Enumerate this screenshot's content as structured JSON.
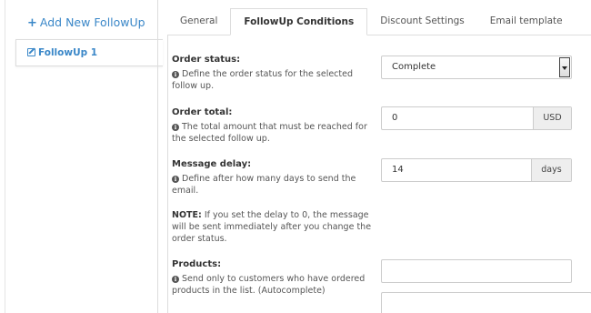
{
  "sidebar": {
    "add_label": "Add New FollowUp",
    "items": [
      {
        "label": "FollowUp 1"
      }
    ]
  },
  "tabs": [
    {
      "label": "General"
    },
    {
      "label": "FollowUp Conditions"
    },
    {
      "label": "Discount Settings"
    },
    {
      "label": "Email template"
    }
  ],
  "fields": {
    "order_status": {
      "label": "Order status:",
      "help": "Define the order status for the selected follow up.",
      "value": "Complete"
    },
    "order_total": {
      "label": "Order total:",
      "help": "The total amount that must be reached for the selected follow up.",
      "value": "0",
      "unit": "USD"
    },
    "message_delay": {
      "label": "Message delay:",
      "help": "Define after how many days to send the email.",
      "note_label": "NOTE:",
      "note": " If you set the delay to 0, the message will be sent immediately after you change the order status.",
      "value": "14",
      "unit": "days"
    },
    "products": {
      "label": "Products:",
      "help": "Send only to customers who have ordered products in the list. (Autocomplete)",
      "value": ""
    }
  }
}
